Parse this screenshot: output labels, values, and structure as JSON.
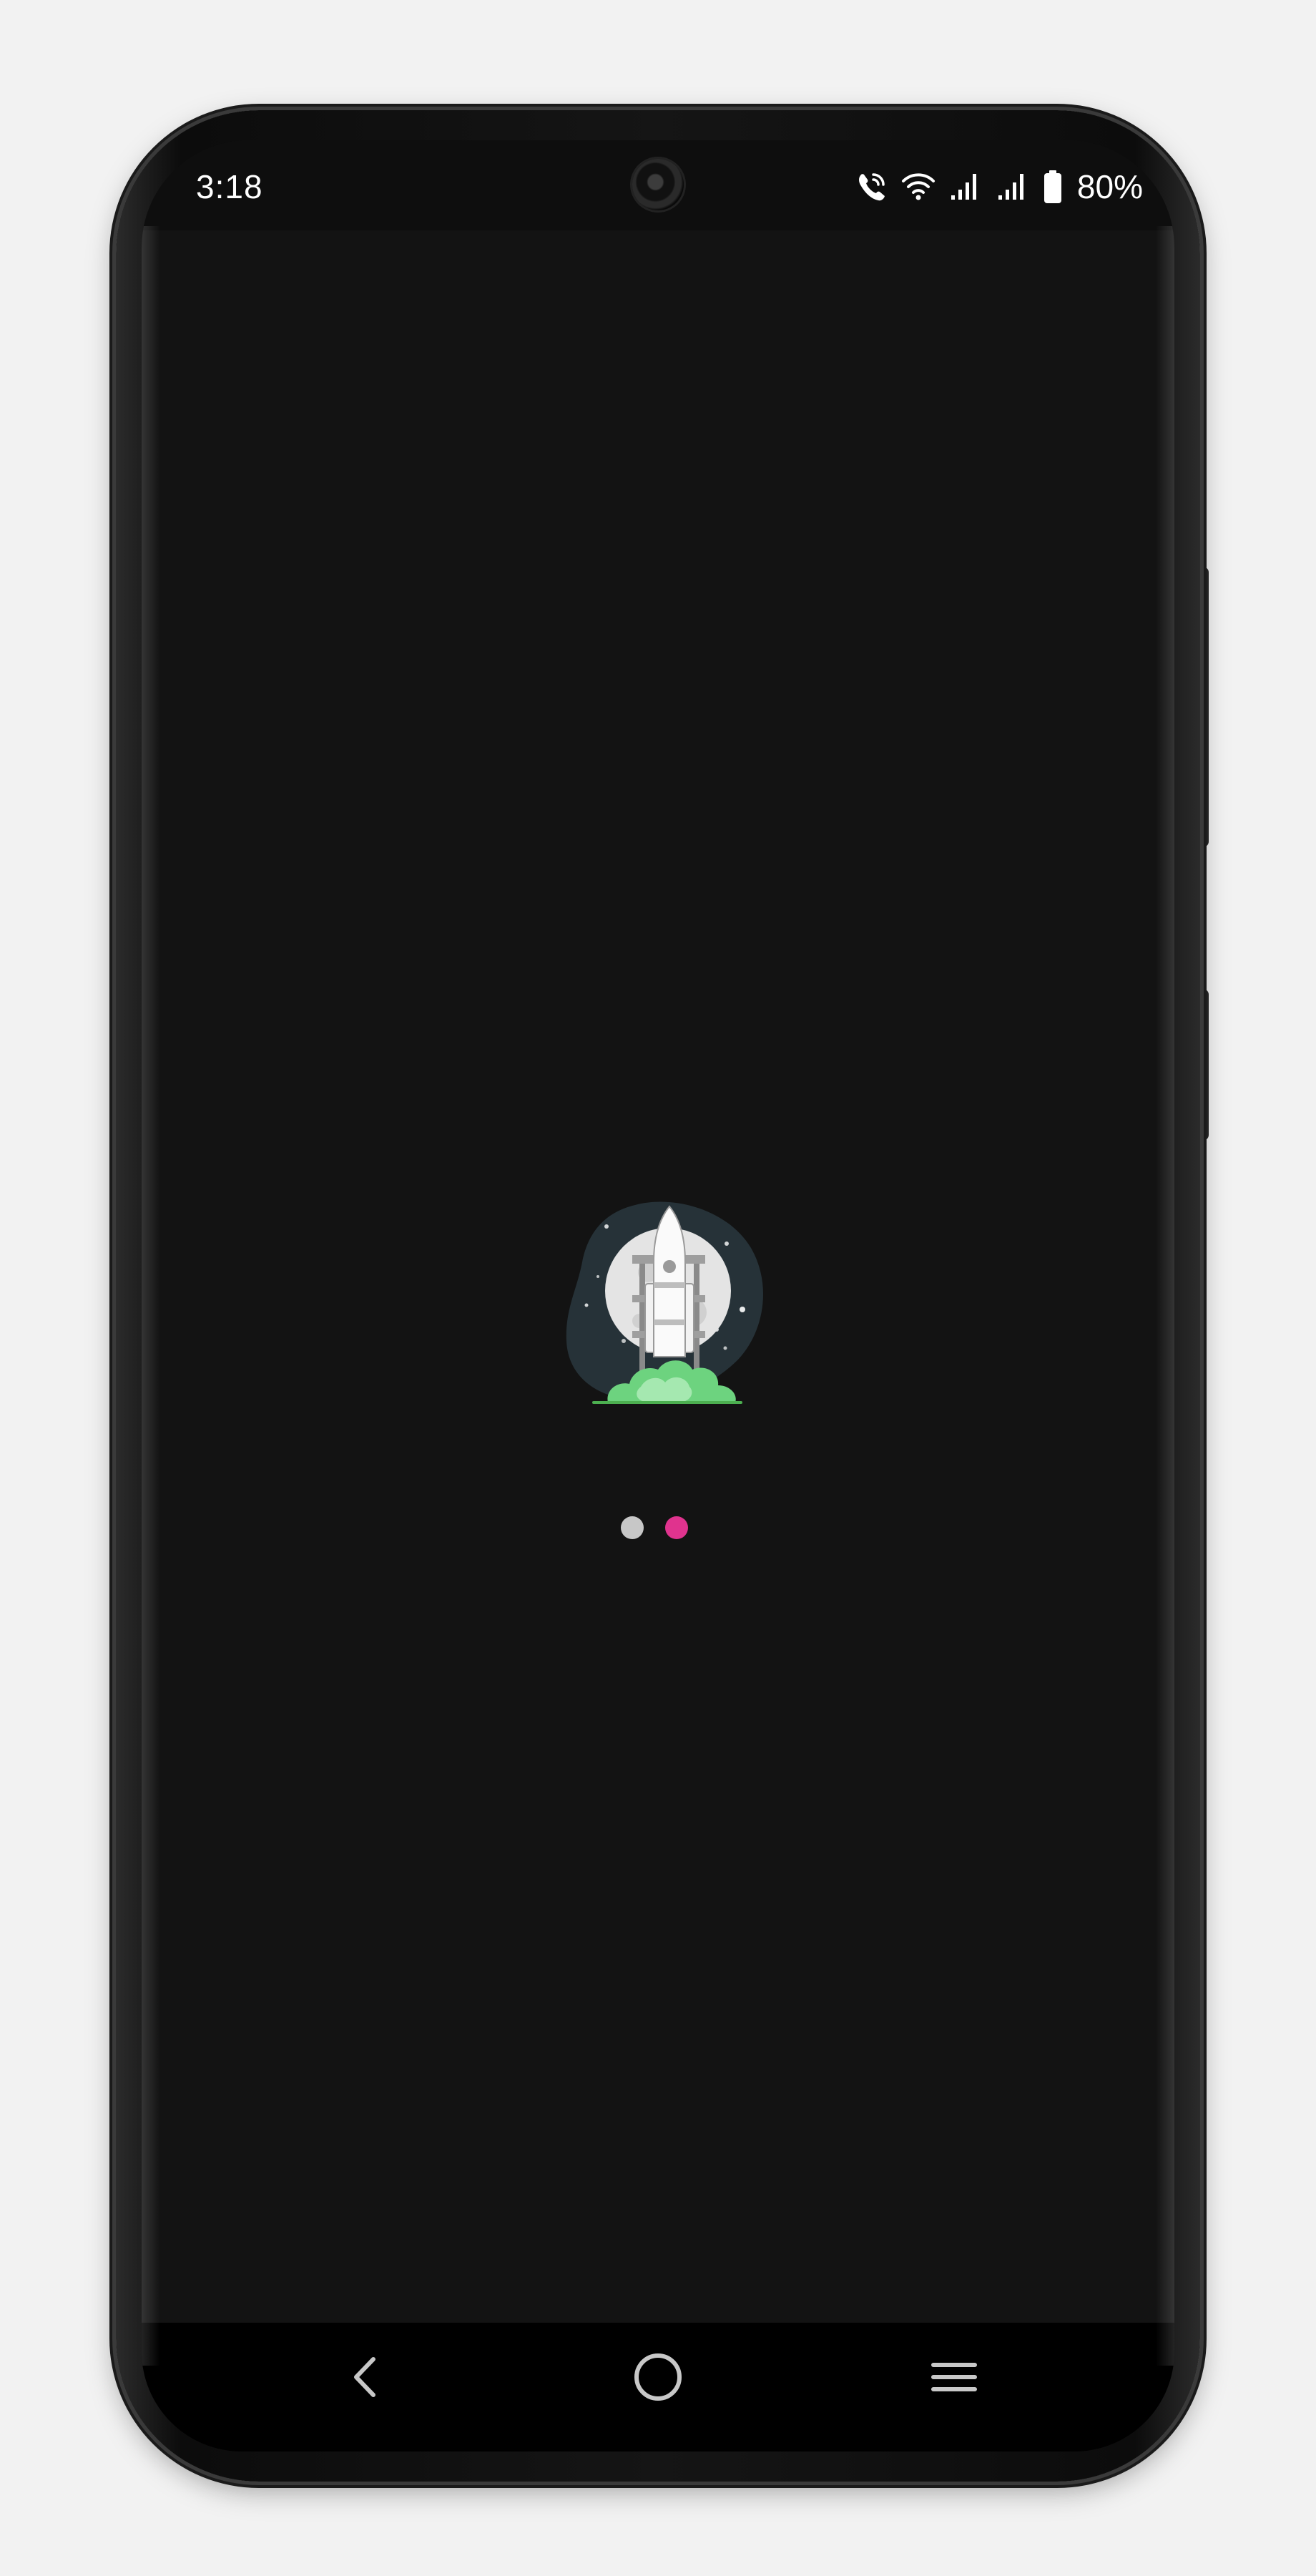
{
  "status_bar": {
    "time": "3:18",
    "icons": [
      "wifi-calling-icon",
      "wifi-icon",
      "signal-strength-icon",
      "signal-strength-icon",
      "battery-icon"
    ],
    "battery_percent": "80%"
  },
  "splash": {
    "illustration": "rocket-launch-illustration",
    "loading_dots": [
      {
        "color": "#c7c7c7"
      },
      {
        "color": "#e0338e"
      }
    ]
  },
  "navigation_bar": {
    "buttons": [
      "back-icon",
      "home-icon",
      "recent-apps-icon"
    ]
  },
  "colors": {
    "background": "#131313",
    "status_bar": "#0e0e0e",
    "navigation_bar": "#000000",
    "accent": "#e0338e",
    "flame": "#6dd37f"
  }
}
